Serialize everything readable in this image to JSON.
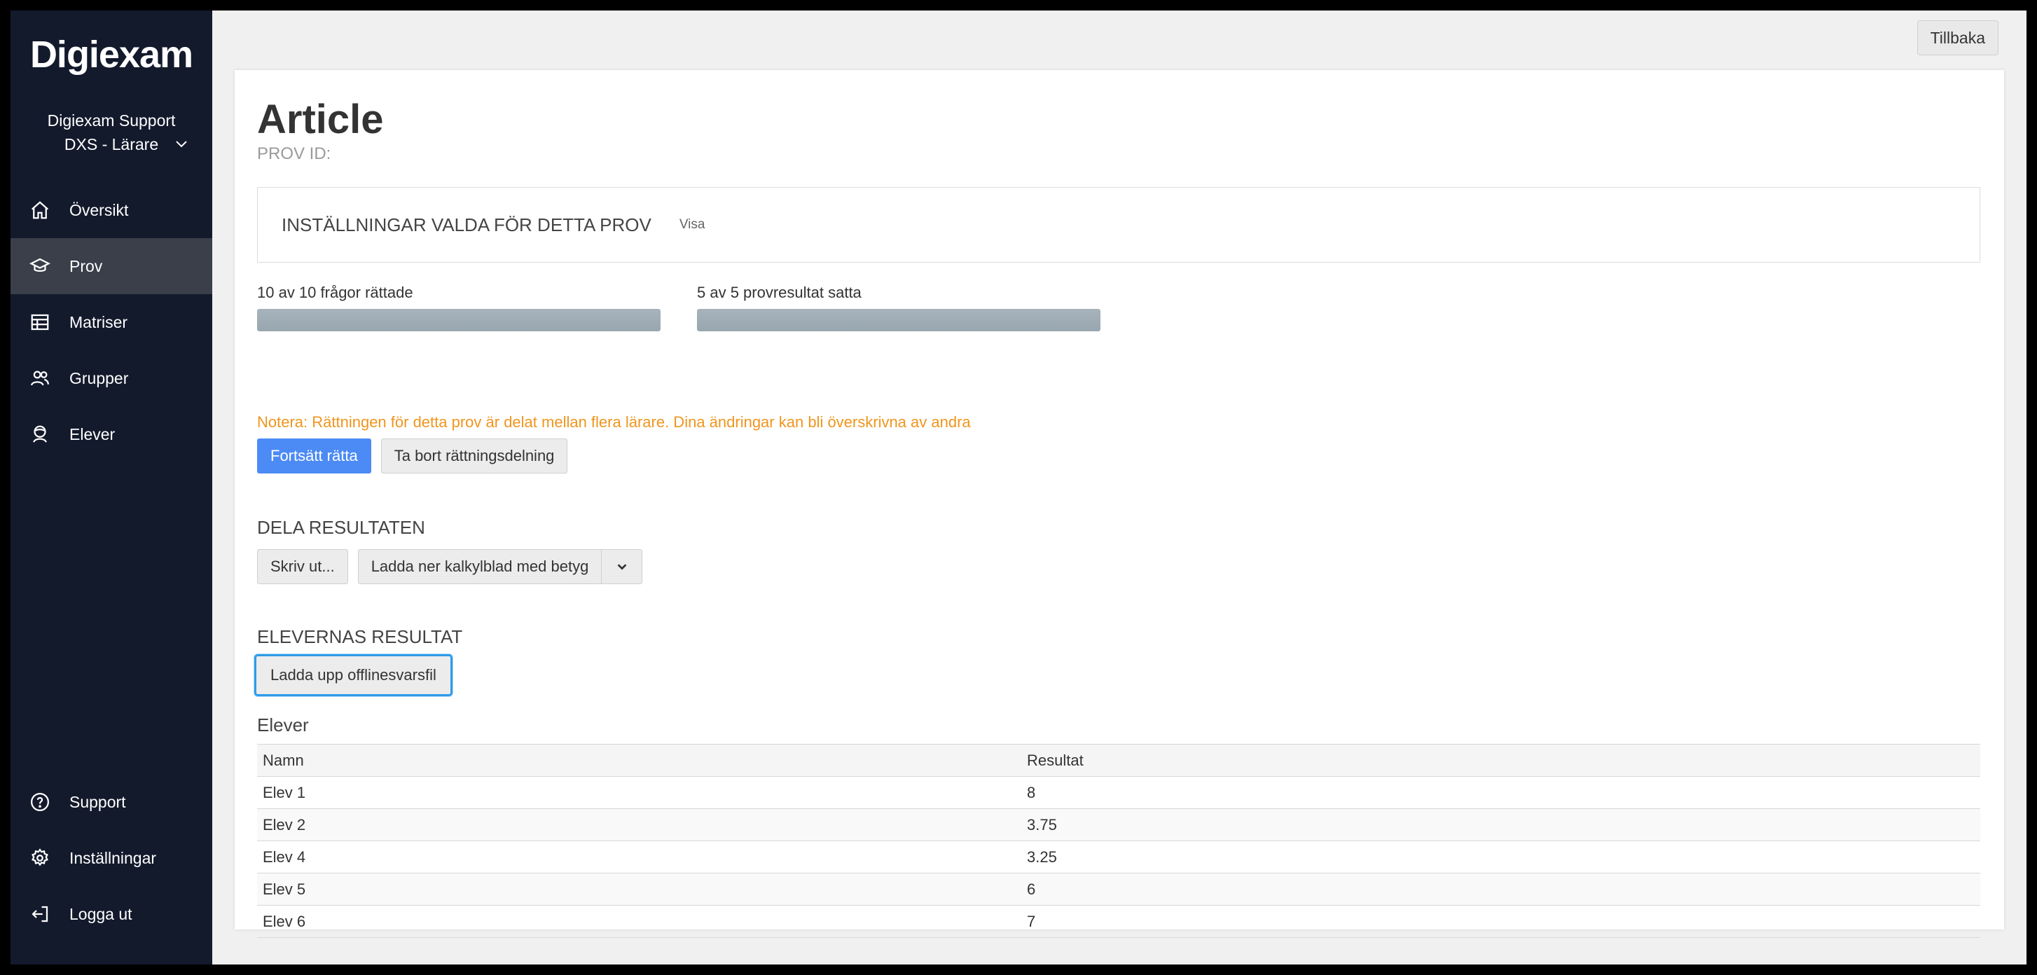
{
  "sidebar": {
    "logo": "Digiexam",
    "account_name": "Digiexam Support",
    "account_role": "DXS - Lärare",
    "items": [
      {
        "label": "Översikt",
        "icon": "home-icon"
      },
      {
        "label": "Prov",
        "icon": "graduation-cap-icon"
      },
      {
        "label": "Matriser",
        "icon": "table-icon"
      },
      {
        "label": "Grupper",
        "icon": "group-icon"
      },
      {
        "label": "Elever",
        "icon": "student-icon"
      }
    ],
    "bottom_items": [
      {
        "label": "Support",
        "icon": "help-circle-icon"
      },
      {
        "label": "Inställningar",
        "icon": "gear-icon"
      },
      {
        "label": "Logga ut",
        "icon": "logout-icon"
      }
    ],
    "active_item": "Prov"
  },
  "header": {
    "back_label": "Tillbaka"
  },
  "main": {
    "title": "Article",
    "prov_id_label": "PROV ID:",
    "settings": {
      "title": "INSTÄLLNINGAR VALDA FÖR DETTA PROV",
      "link": "Visa"
    },
    "progress": [
      {
        "label": "10 av 10 frågor rättade",
        "fraction": 1.0
      },
      {
        "label": "5 av 5 provresultat satta",
        "fraction": 1.0
      }
    ],
    "note": "Notera: Rättningen för detta prov är delat mellan flera lärare. Dina ändringar kan bli överskrivna av andra",
    "continue_label": "Fortsätt rätta",
    "remove_sharing_label": "Ta bort rättningsdelning",
    "share_title": "DELA RESULTATEN",
    "print_label": "Skriv ut...",
    "download_label": "Ladda ner kalkylblad med betyg",
    "results_title": "ELEVERNAS RESULTAT",
    "upload_label": "Ladda upp offlinesvarsfil",
    "students_title": "Elever",
    "table": {
      "headers": [
        "Namn",
        "Resultat"
      ],
      "rows": [
        [
          "Elev 1",
          "8"
        ],
        [
          "Elev 2",
          "3.75"
        ],
        [
          "Elev 4",
          "3.25"
        ],
        [
          "Elev 5",
          "6"
        ],
        [
          "Elev 6",
          "7"
        ]
      ]
    }
  },
  "colors": {
    "sidebar_bg": "#131a2c",
    "sidebar_active": "#3a3f4a",
    "primary": "#4c8bf5",
    "note": "#f0951e",
    "focus": "#2f9be8"
  }
}
